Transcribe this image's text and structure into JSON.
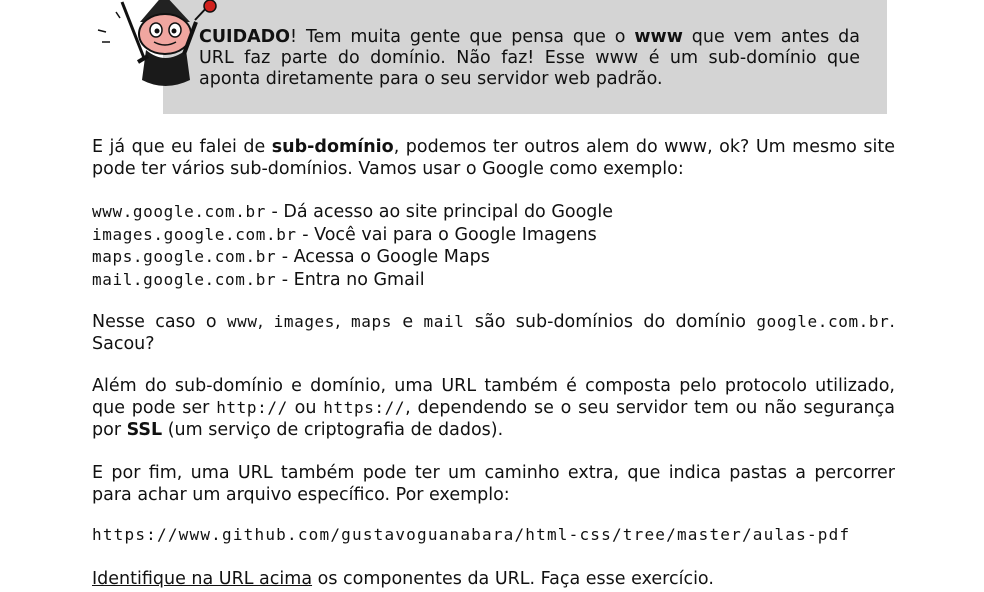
{
  "callout": {
    "warning_word": "CUIDADO",
    "text_1": "! Tem muita gente que pensa que o ",
    "www_bold": "www",
    "text_2": " que vem antes da URL faz parte do domínio. Não faz! Esse www é um sub-domínio que aponta diretamente para o seu servidor web padrão."
  },
  "p1": {
    "part1": "E já que eu falei de ",
    "bold": "sub-domínio",
    "part2": ", podemos ter outros alem do www, ok? Um mesmo site pode ter vários sub-domínios. Vamos usar o Google como exemplo:"
  },
  "subdomains": [
    {
      "host": "www.google.com.br",
      "desc": " - Dá acesso ao site principal do Google"
    },
    {
      "host": "images.google.com.br",
      "desc": " - Você vai para o Google Imagens"
    },
    {
      "host": "maps.google.com.br",
      "desc": " - Acessa o Google Maps"
    },
    {
      "host": "mail.google.com.br",
      "desc": " - Entra no Gmail"
    }
  ],
  "p2": {
    "t1": "Nesse caso o ",
    "c1": "www",
    "t2": ", ",
    "c2": "images",
    "t3": ", ",
    "c3": "maps",
    "t4": " e ",
    "c4": "mail",
    "t5": " são sub-domínios do domínio ",
    "c5": "google.com.br",
    "t6": ". Sacou?"
  },
  "p3": {
    "t1": "Além do sub-domínio e domínio, uma URL também é composta pelo protocolo utilizado, que pode ser ",
    "c1": "http://",
    "t2": " ou ",
    "c2": "https://",
    "t3": ", dependendo se o seu servidor tem ou não segurança por ",
    "bold": "SSL",
    "t4": " (um serviço de criptografia de dados)."
  },
  "p4": {
    "text": "E por fim, uma URL também pode ter um caminho extra, que indica pastas a percorrer para achar um arquivo específico. Por exemplo:"
  },
  "example_url": "https://www.github.com/gustavoguanabara/html-css/tree/master/aulas-pdf",
  "p5": {
    "underlined": "Identifique na URL acima",
    "rest": " os componentes da URL. Faça esse exercício."
  }
}
